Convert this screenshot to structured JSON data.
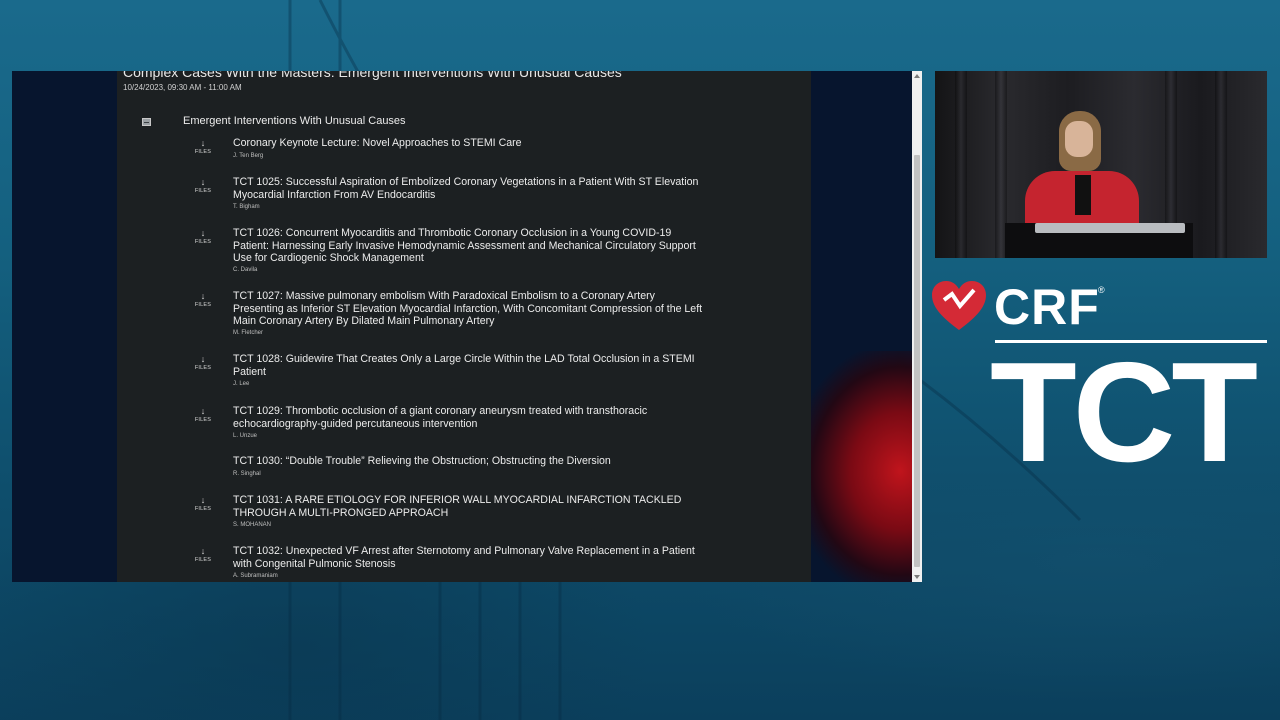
{
  "slide": {
    "session_title": "Complex Cases With the Masters: Emergent Interventions With Unusual Causes",
    "session_datetime": "10/24/2023, 09:30 AM - 11:00 AM",
    "section": {
      "label": "Emergent Interventions With Unusual Causes",
      "collapse_icon": "collapse-box-icon"
    },
    "files_label": "FILES",
    "files_icon": "download-arrow-icon",
    "items": [
      {
        "title": "Coronary Keynote Lecture: Novel Approaches to STEMI Care",
        "author": "J. Ten Berg",
        "has_files": true
      },
      {
        "title": "TCT 1025: Successful Aspiration of Embolized Coronary Vegetations in a Patient With ST Elevation Myocardial Infarction From AV Endocarditis",
        "author": "T. Bigham",
        "has_files": true
      },
      {
        "title": "TCT 1026: Concurrent Myocarditis and Thrombotic Coronary Occlusion in a Young COVID-19 Patient: Harnessing Early Invasive Hemodynamic Assessment and Mechanical Circulatory Support Use for Cardiogenic Shock Management",
        "author": "C. Davila",
        "has_files": true
      },
      {
        "title": "TCT 1027: Massive pulmonary embolism With Paradoxical Embolism to a Coronary Artery Presenting as Inferior ST Elevation Myocardial Infarction, With Concomitant Compression of the Left Main Coronary Artery By Dilated Main Pulmonary Artery",
        "author": "M. Fletcher",
        "has_files": true
      },
      {
        "title": "TCT 1028: Guidewire That Creates Only a Large Circle Within the LAD Total Occlusion in a STEMI Patient",
        "author": "J. Lee",
        "has_files": true
      },
      {
        "title": "TCT 1029: Thrombotic occlusion of a giant coronary aneurysm treated with transthoracic echocardiography-guided percutaneous intervention",
        "author": "L. Unzue",
        "has_files": true
      },
      {
        "title": "TCT 1030: “Double Trouble” Relieving the Obstruction; Obstructing the Diversion",
        "author": "R. Singhal",
        "has_files": false
      },
      {
        "title": "TCT 1031: A RARE ETIOLOGY FOR INFERIOR WALL MYOCARDIAL INFARCTION TACKLED THROUGH A MULTI-PRONGED APPROACH",
        "author": "S. MOHANAN",
        "has_files": true
      },
      {
        "title": "TCT 1032: Unexpected VF Arrest after Sternotomy and Pulmonary Valve Replacement in a Patient with Congenital Pulmonic Stenosis",
        "author": "A. Subramaniam",
        "has_files": true
      }
    ]
  },
  "branding": {
    "crf_text": "CRF",
    "crf_reg": "®",
    "tct_text": "TCT",
    "heart_color": "#d42a36",
    "accent_white": "#ffffff"
  },
  "colors": {
    "background": "#14607f",
    "panel": "#1c2022",
    "presenter_jacket": "#c5242f"
  }
}
